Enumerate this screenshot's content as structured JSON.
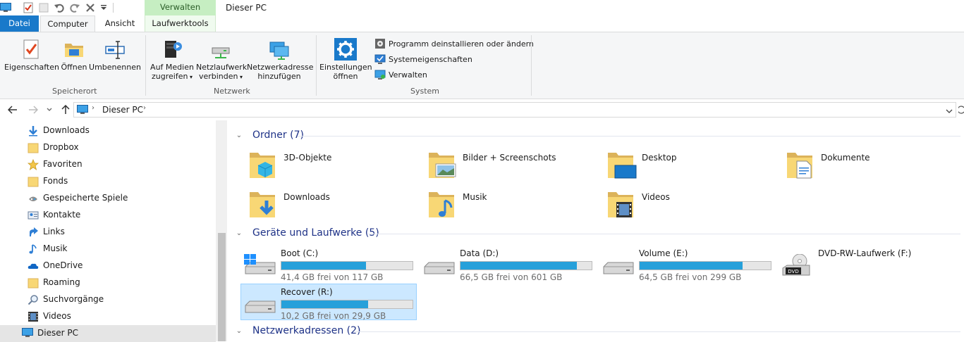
{
  "window": {
    "title": "Dieser PC",
    "context_tab_header": "Verwalten"
  },
  "tabs": {
    "datei": "Datei",
    "computer": "Computer",
    "ansicht": "Ansicht",
    "laufwerktools": "Laufwerktools"
  },
  "ribbon": {
    "eigenschaften": "Eigenschaften",
    "oeffnen": "Öffnen",
    "umbenennen": "Umbenennen",
    "speicherort": "Speicherort",
    "medien_l1": "Auf Medien",
    "medien_l2": "zugreifen",
    "netzlw_l1": "Netzlaufwerk",
    "netzlw_l2": "verbinden",
    "netzadr_l1": "Netzwerkadresse",
    "netzadr_l2": "hinzufügen",
    "netzwerk": "Netzwerk",
    "einst_l1": "Einstellungen",
    "einst_l2": "öffnen",
    "programm": "Programm deinstallieren oder ändern",
    "systemeig": "Systemeigenschaften",
    "verwalten": "Verwalten",
    "system": "System"
  },
  "address": {
    "path": "Dieser PC"
  },
  "sidebar": {
    "items": [
      {
        "label": "Downloads"
      },
      {
        "label": "Dropbox"
      },
      {
        "label": "Favoriten"
      },
      {
        "label": "Fonds"
      },
      {
        "label": "Gespeicherte Spiele"
      },
      {
        "label": "Kontakte"
      },
      {
        "label": "Links"
      },
      {
        "label": "Musik"
      },
      {
        "label": "OneDrive"
      },
      {
        "label": "Roaming"
      },
      {
        "label": "Suchvorgänge"
      },
      {
        "label": "Videos"
      },
      {
        "label": "Dieser PC"
      }
    ]
  },
  "content": {
    "folders_header": "Ordner (7)",
    "folders": [
      {
        "name": "3D-Objekte",
        "icon": "3d-objects-folder-icon"
      },
      {
        "name": "Bilder + Screenschots",
        "icon": "pictures-folder-icon"
      },
      {
        "name": "Desktop",
        "icon": "desktop-folder-icon"
      },
      {
        "name": "Dokumente",
        "icon": "documents-folder-icon"
      },
      {
        "name": "Downloads",
        "icon": "downloads-folder-icon"
      },
      {
        "name": "Musik",
        "icon": "music-folder-icon"
      },
      {
        "name": "Videos",
        "icon": "videos-folder-icon"
      }
    ],
    "drives_header": "Geräte und Laufwerke (5)",
    "drives": [
      {
        "name": "Boot (C:)",
        "free": "41,4 GB frei von 117 GB",
        "used_fraction": 0.646
      },
      {
        "name": "Data (D:)",
        "free": "66,5 GB frei von 601 GB",
        "used_fraction": 0.889
      },
      {
        "name": "Volume (E:)",
        "free": "64,5 GB frei von 299 GB",
        "used_fraction": 0.784
      },
      {
        "name": "DVD-RW-Laufwerk (F:)",
        "free": "",
        "used_fraction": null
      },
      {
        "name": "Recover (R:)",
        "free": "10,2 GB frei von 29,9 GB",
        "used_fraction": 0.659
      }
    ],
    "network_header": "Netzwerkadressen (2)"
  },
  "colors": {
    "accent": "#1979ca",
    "header_text": "#1e3287",
    "bar_fill": "#26a0da",
    "context_tab": "#c6eec2",
    "selection": "#cce8ff"
  }
}
